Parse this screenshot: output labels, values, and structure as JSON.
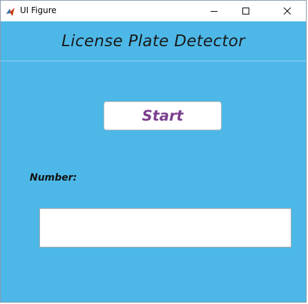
{
  "window": {
    "title": "UI Figure",
    "app_icon": "matlab-icon",
    "controls": {
      "minimize_icon": "minimize-icon",
      "maximize_icon": "maximize-icon",
      "close_icon": "close-icon"
    }
  },
  "app": {
    "title": "License Plate Detector",
    "start_label": "Start",
    "number_label": "Number:",
    "number_value": ""
  },
  "colors": {
    "background": "#4db8e8",
    "start_text": "#7b3f8f",
    "titlebar": "#ffffff"
  }
}
